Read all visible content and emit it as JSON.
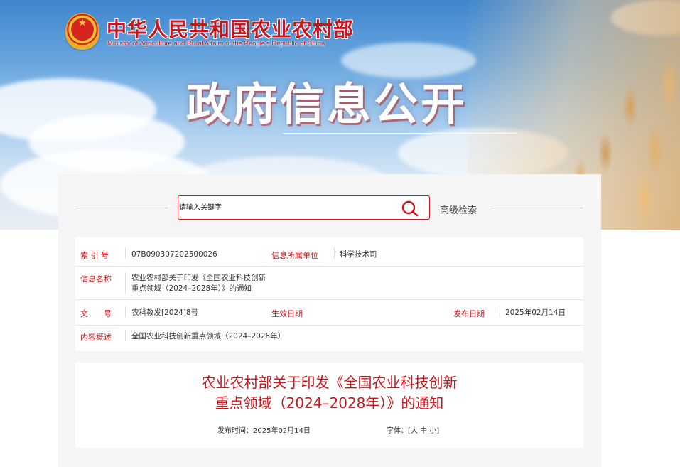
{
  "header": {
    "site_name": "中华人民共和国农业农村部",
    "site_name_en": "Ministry of Agriculture and Rural Affairs of the People's Republic of China",
    "hero_title": "政府信息公开"
  },
  "search": {
    "placeholder": "请输入关键字",
    "advanced_label": "高级检索",
    "icon": "search-icon"
  },
  "meta": {
    "index_label": "索 引 号",
    "index_value": "07B090307202500026",
    "unit_label": "信息所属单位",
    "unit_value": "科学技术司",
    "name_label": "信息名称",
    "name_value_line1": "农业农村部关于印发《全国农业科技创新",
    "name_value_line2": "重点领域（2024–2028年）》的通知",
    "doc_label": "文　　号",
    "doc_value": "农科教发[2024]8号",
    "effective_label": "生效日期",
    "effective_value": "",
    "publish_label": "发布日期",
    "publish_value": "2025年02月14日",
    "summary_label": "内容概述",
    "summary_value": "全国农业科技创新重点领域（2024–2028年）"
  },
  "article": {
    "title_line1": "农业农村部关于印发《全国农业科技创新",
    "title_line2": "重点领域（2024–2028年）》的通知",
    "publish_time": "发布时间：2025年02月14日",
    "font_label": "字体：",
    "font_open": "[",
    "font_large": "大",
    "font_medium": "中",
    "font_small": "小",
    "font_close": "]"
  },
  "colors": {
    "brand_red": "#c8161d",
    "label_red": "#c8161d"
  }
}
